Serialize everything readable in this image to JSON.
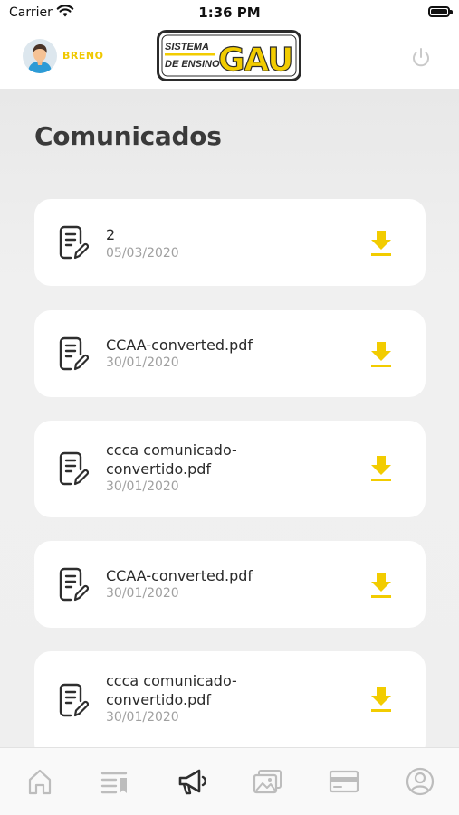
{
  "status_bar": {
    "carrier": "Carrier",
    "time": "1:36 PM"
  },
  "header": {
    "user_name": "BRENO",
    "logo_line1": "SISTEMA",
    "logo_line2": "DE ENSINO",
    "logo_brand": "GAU"
  },
  "page": {
    "title": "Comunicados"
  },
  "announcements": [
    {
      "name": "2",
      "date": "05/03/2020"
    },
    {
      "name": "CCAA-converted.pdf",
      "date": "30/01/2020"
    },
    {
      "name_line1": "ccca comunicado-",
      "name_line2": "convertido.pdf",
      "date": "30/01/2020"
    },
    {
      "name": "CCAA-converted.pdf",
      "date": "30/01/2020"
    },
    {
      "name_line1": "ccca comunicado-",
      "name_line2": "convertido.pdf",
      "date": "30/01/2020"
    }
  ],
  "tab_bar": {
    "items": [
      "home-icon",
      "list-bookmark-icon",
      "megaphone-icon",
      "gallery-icon",
      "card-icon",
      "profile-icon"
    ],
    "active": "megaphone-icon"
  },
  "colors": {
    "accent": "#f2cc00",
    "icon": "#2e2e2e",
    "inactive_icon": "#bdbdbd"
  }
}
